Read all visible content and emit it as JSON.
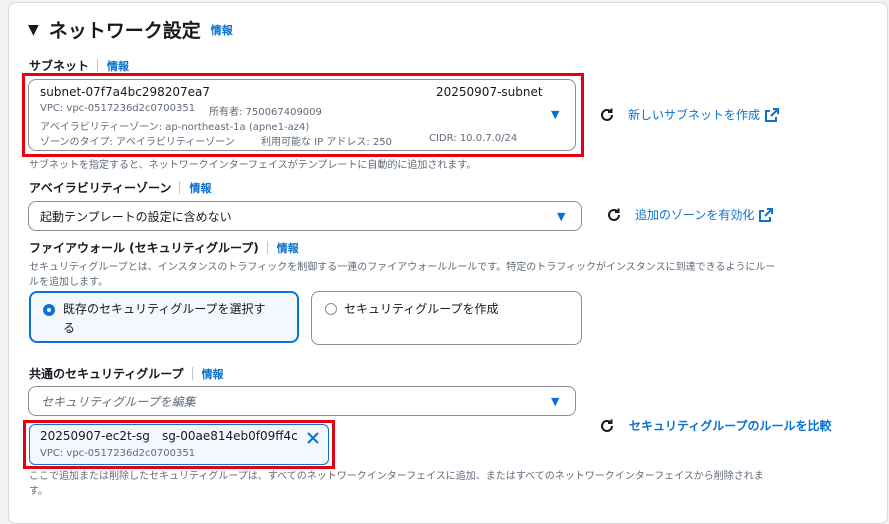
{
  "section": {
    "title": "ネットワーク設定",
    "info": "情報"
  },
  "subnet": {
    "label": "サブネット",
    "info": "情報",
    "id": "subnet-07f7a4bc298207ea7",
    "name": "20250907-subnet",
    "vpc": "VPC: vpc-0517236d2c0700351",
    "owner": "所有者: 750067409009",
    "az": "アベイラビリティーゾーン: ap-northeast-1a (apne1-az4)",
    "zone_type": "ゾーンのタイプ: アベイラビリティーゾーン",
    "ip": "利用可能な IP アドレス: 250",
    "cidr": "CIDR: 10.0.7.0/24",
    "create_link": "新しいサブネットを作成",
    "hint": "サブネットを指定すると、ネットワークインターフェイスがテンプレートに自動的に追加されます。"
  },
  "az": {
    "label": "アベイラビリティーゾーン",
    "info": "情報",
    "value": "起動テンプレートの設定に含めない",
    "enable_link": "追加のゾーンを有効化"
  },
  "firewall": {
    "label": "ファイアウォール (セキュリティグループ)",
    "info": "情報",
    "desc1": "セキュリティグループとは、インスタンスのトラフィックを制御する一連のファイアウォールルールです。特定のトラフィックがインスタンスに到達できるようにルー",
    "desc2": "ルを追加します。",
    "option_existing_1": "既存のセキュリティグループを選択す",
    "option_existing_2": "る",
    "option_create": "セキュリティグループを作成"
  },
  "common_sg": {
    "label": "共通のセキュリティグループ",
    "info": "情報",
    "placeholder": "セキュリティグループを編集",
    "compare_link": "セキュリティグループのルールを比較",
    "token_name": "20250907-ec2t-sg",
    "token_id": "sg-00ae814eb0f09ff4c",
    "token_vpc": "VPC: vpc-0517236d2c0700351",
    "hint1": "ここで追加または削除したセキュリティグループは、すべてのネットワークインターフェイスに追加、またはすべてのネットワークインターフェイスから削除されま",
    "hint2": "す。"
  },
  "colors": {
    "accent": "#0972d3",
    "highlight": "#e60012",
    "selected_bg": "#f2f8fd"
  },
  "icons": [
    "caret-down-icon",
    "refresh-icon",
    "external-link-icon",
    "close-icon",
    "radio-icon"
  ]
}
